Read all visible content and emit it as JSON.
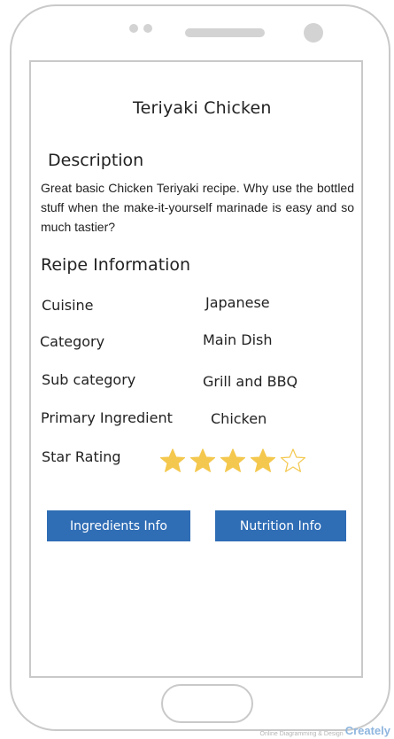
{
  "recipe": {
    "title": "Teriyaki Chicken",
    "description_heading": "Description",
    "description_text": "Great basic Chicken Teriyaki recipe. Why use the bottled stuff when the make-it-yourself marinade is easy and so much tastier?",
    "info_heading": "Reipe Information",
    "fields": [
      {
        "label": "Cuisine",
        "value": "Japanese"
      },
      {
        "label": "Category",
        "value": "Main Dish"
      },
      {
        "label": "Sub category",
        "value": "Grill and BBQ"
      },
      {
        "label": "Primary Ingredient",
        "value": "Chicken"
      }
    ],
    "rating_label": "Star Rating",
    "rating": 4,
    "rating_max": 5
  },
  "buttons": {
    "ingredients": "Ingredients Info",
    "nutrition": "Nutrition Info"
  },
  "colors": {
    "button": "#2f6db5",
    "star_filled": "#f4c84e",
    "star_empty_stroke": "#f4c84e"
  },
  "icons": {
    "star_filled": "star-filled-icon",
    "star_empty": "star-empty-icon"
  },
  "watermark": {
    "tagline": "Online Diagramming & Design",
    "brand": "Creately"
  }
}
